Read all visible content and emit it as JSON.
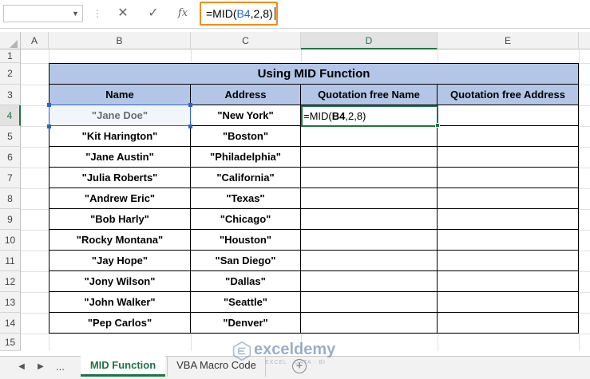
{
  "formula_bar": {
    "name_box_value": "",
    "cancel_icon": "cancel-icon",
    "enter_icon": "checkmark-icon",
    "fx_label": "fx",
    "formula_prefix": "=MID(",
    "formula_ref": "B4",
    "formula_suffix": ",2,8)"
  },
  "columns": [
    "A",
    "B",
    "C",
    "D",
    "E"
  ],
  "rows": [
    "1",
    "2",
    "3",
    "4",
    "5",
    "6",
    "7",
    "8",
    "9",
    "10",
    "11",
    "12",
    "13",
    "14",
    "15"
  ],
  "table": {
    "title": "Using MID Function",
    "headers": [
      "Name",
      "Address",
      "Quotation free Name",
      "Quotation free Address"
    ],
    "rows": [
      {
        "name": "\"Jane Doe\"",
        "address": "\"New York\"",
        "qf_name": "=MID(B4,2,8)",
        "qf_address": ""
      },
      {
        "name": "\"Kit Harington\"",
        "address": "\"Boston\"",
        "qf_name": "",
        "qf_address": ""
      },
      {
        "name": "\"Jane Austin\"",
        "address": "\"Philadelphia\"",
        "qf_name": "",
        "qf_address": ""
      },
      {
        "name": "\"Julia Roberts\"",
        "address": "\"California\"",
        "qf_name": "",
        "qf_address": ""
      },
      {
        "name": "\"Andrew Eric\"",
        "address": "\"Texas\"",
        "qf_name": "",
        "qf_address": ""
      },
      {
        "name": "\"Bob Harly\"",
        "address": "\"Chicago\"",
        "qf_name": "",
        "qf_address": ""
      },
      {
        "name": "\"Rocky Montana\"",
        "address": "\"Houston\"",
        "qf_name": "",
        "qf_address": ""
      },
      {
        "name": "\"Jay Hope\"",
        "address": "\"San Diego\"",
        "qf_name": "",
        "qf_address": ""
      },
      {
        "name": "\"Jony Wilson\"",
        "address": "\"Dallas\"",
        "qf_name": "",
        "qf_address": ""
      },
      {
        "name": "\"John Walker\"",
        "address": "\"Seattle\"",
        "qf_name": "",
        "qf_address": ""
      },
      {
        "name": "\"Pep Carlos\"",
        "address": "\"Denver\"",
        "qf_name": "",
        "qf_address": ""
      }
    ]
  },
  "active_cell": {
    "column": "D",
    "row": "4",
    "edit_prefix": "=MID(",
    "edit_ref": "B4",
    "edit_suffix": ",2,8)"
  },
  "sheet_tabs": {
    "ellipsis": "...",
    "tabs": [
      "MID Function",
      "VBA Macro Code"
    ],
    "active": "MID Function",
    "add_icon": "plus-circle-icon"
  },
  "watermark": {
    "brand": "exceldemy",
    "tagline": "EXCEL · DATA · BI"
  },
  "colors": {
    "header_fill": "#b4c6e7",
    "excel_green": "#217346",
    "formula_highlight": "#f08c1a",
    "ref_blue": "#2b63c7"
  }
}
